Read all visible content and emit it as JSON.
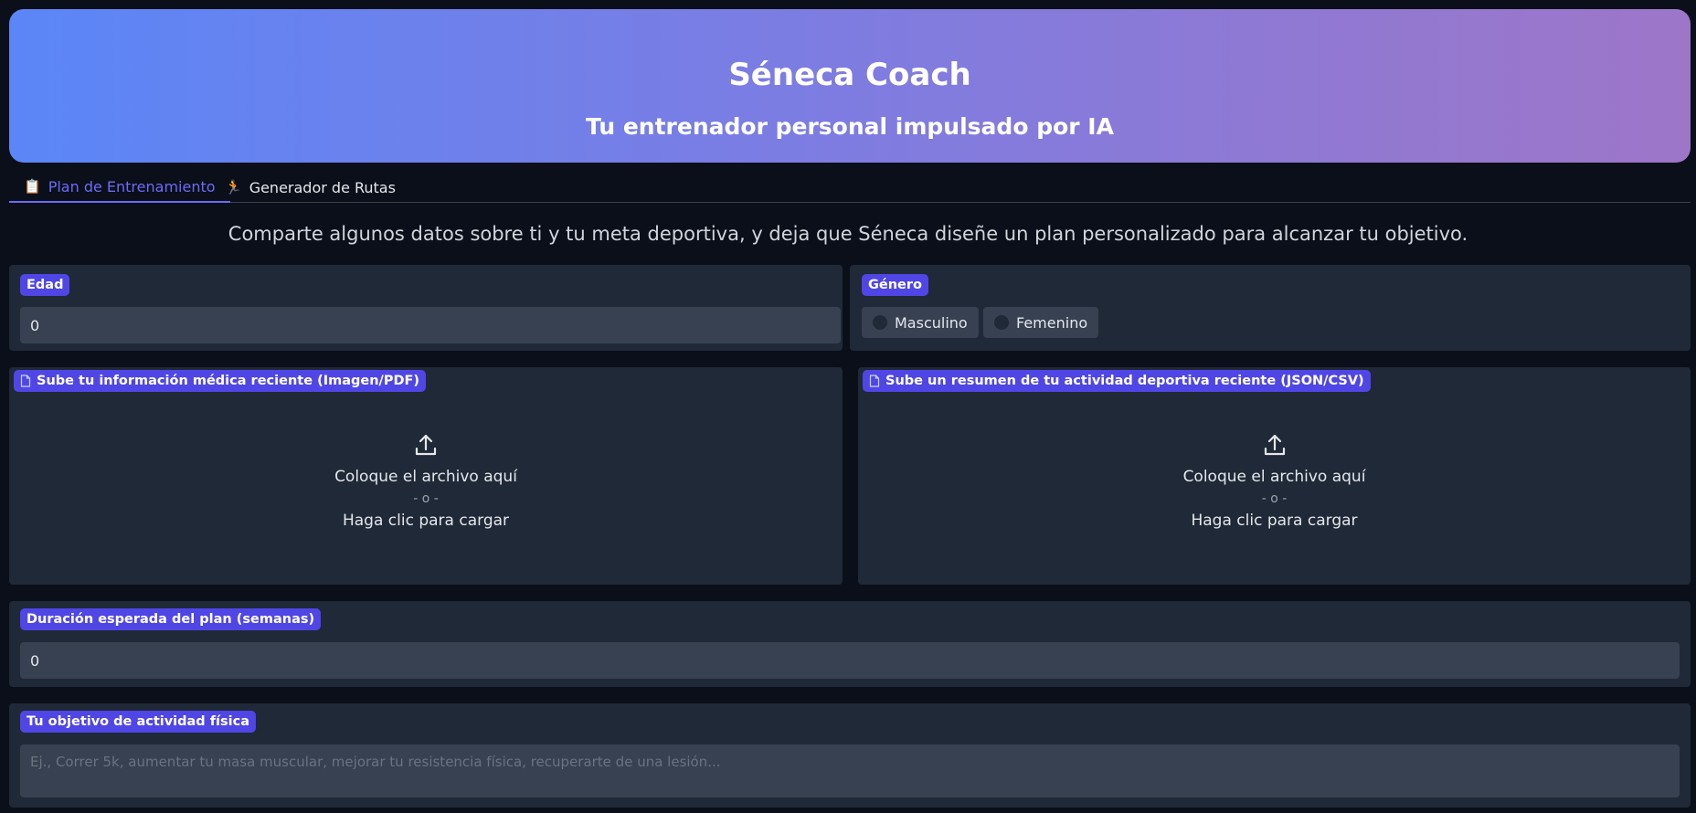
{
  "header": {
    "title": "Séneca Coach",
    "subtitle": "Tu entrenador personal impulsado por IA"
  },
  "tabs": [
    {
      "label": "Plan de Entrenamiento",
      "icon": "clipboard-icon",
      "active": true
    },
    {
      "label": "Generador de Rutas",
      "icon": "runner-icon",
      "active": false
    }
  ],
  "description": "Comparte algunos datos sobre ti y tu meta deportiva, y deja que Séneca diseñe un plan personalizado para alcanzar tu objetivo.",
  "age": {
    "label": "Edad",
    "value": "0"
  },
  "gender": {
    "label": "Género",
    "options": [
      "Masculino",
      "Femenino"
    ]
  },
  "medical_upload": {
    "label": "Sube tu información médica reciente (Imagen/PDF)",
    "drop_text": "Coloque el archivo aquí",
    "or_text": "- o -",
    "click_text": "Haga clic para cargar"
  },
  "activity_upload": {
    "label": "Sube un resumen de tu actividad deportiva reciente (JSON/CSV)",
    "drop_text": "Coloque el archivo aquí",
    "or_text": "- o -",
    "click_text": "Haga clic para cargar"
  },
  "duration": {
    "label": "Duración esperada del plan (semanas)",
    "value": "0"
  },
  "goal": {
    "label": "Tu objetivo de actividad física",
    "placeholder": "Ej., Correr 5k, aumentar tu masa muscular, mejorar tu resistencia física, recuperarte de una lesión..."
  },
  "colors": {
    "background": "#0b0f19",
    "panel": "#1f2937",
    "input": "#374151",
    "accent": "#4f46e5",
    "tab_active": "#6d6af5",
    "hero_gradient_start": "#5b86f7",
    "hero_gradient_end": "#9d76c8"
  }
}
